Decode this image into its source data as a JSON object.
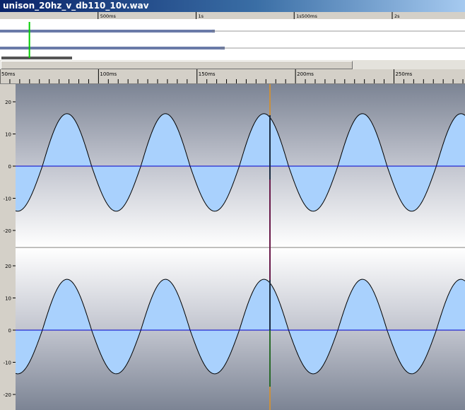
{
  "window": {
    "title": "unison_20hz_v_db110_10v.wav"
  },
  "overview_ruler": {
    "labels": [
      "500ms",
      "1s",
      "1s500ms",
      "2s"
    ],
    "times_ms": [
      500,
      1000,
      1500,
      2000
    ]
  },
  "overview": {
    "cursor_ms": 150
  },
  "timeline": {
    "labels": [
      "50ms",
      "100ms",
      "150ms",
      "200ms",
      "250ms"
    ],
    "view_start_ms": 50,
    "view_end_ms": 285
  },
  "cursor": {
    "time_ms": 184
  },
  "channels": [
    {
      "amplitude_labels": [
        "20",
        "10",
        "0",
        "-10",
        "-20"
      ],
      "amplitude_values": [
        20,
        10,
        0,
        -10,
        -20
      ]
    },
    {
      "amplitude_labels": [
        "20",
        "10",
        "0",
        "-10",
        "-20"
      ],
      "amplitude_values": [
        20,
        10,
        0,
        -10,
        -20
      ]
    }
  ],
  "colors": {
    "wave_fill": "#a9d1fd",
    "wave_outline": "#000000",
    "zero_line": "#0000cc",
    "cursor_line": "#c89040",
    "overview_cursor": "#00cc00"
  }
}
